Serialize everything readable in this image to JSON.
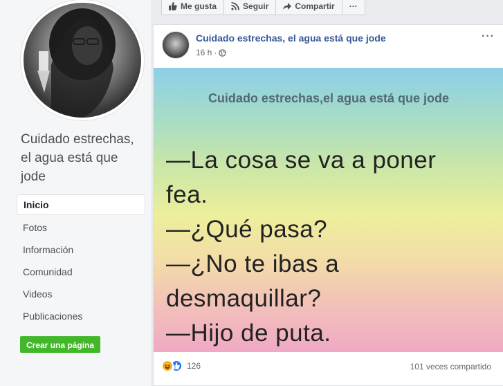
{
  "sidebar": {
    "page_name": "Cuidado estrechas, el agua está que jode",
    "nav": [
      {
        "label": "Inicio",
        "active": true
      },
      {
        "label": "Fotos",
        "active": false
      },
      {
        "label": "Información",
        "active": false
      },
      {
        "label": "Comunidad",
        "active": false
      },
      {
        "label": "Videos",
        "active": false
      },
      {
        "label": "Publicaciones",
        "active": false
      }
    ],
    "create_page_label": "Crear una página"
  },
  "actions": {
    "like_label": "Me gusta",
    "follow_label": "Seguir",
    "share_label": "Compartir",
    "more_label": "···"
  },
  "post": {
    "author": "Cuidado estrechas, el agua está que jode",
    "time": "16 h",
    "separator": "·",
    "more_label": "···",
    "image": {
      "caption": "Cuidado estrechas,el agua está que jode",
      "lines": [
        "—La cosa se va a poner",
        "fea.",
        "—¿Qué pasa?",
        "—¿No te ibas a",
        "desmaquillar?",
        "—Hijo de puta."
      ]
    },
    "reaction_count": "126",
    "shares_text": "101 veces compartido"
  },
  "colors": {
    "link_blue": "#365899",
    "create_green": "#42b72a",
    "like_blue": "#2078f4",
    "haha_yellow": "#f7b125"
  }
}
